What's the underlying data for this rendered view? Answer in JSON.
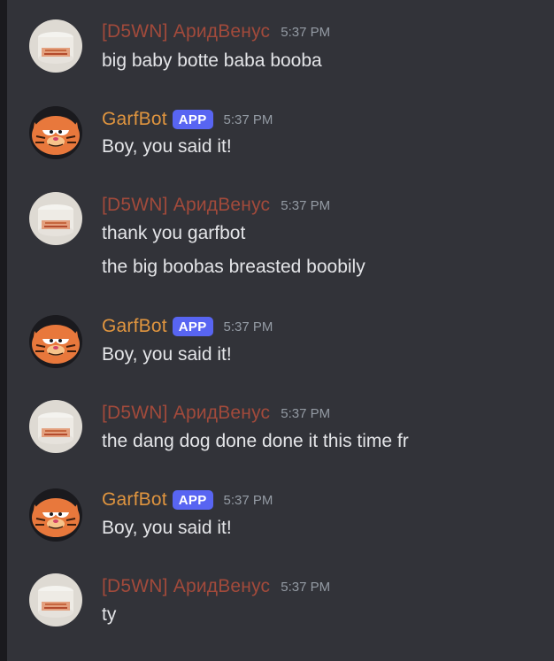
{
  "messages": [
    {
      "author": "[D5WN] АридВенус",
      "author_type": "user",
      "avatar_icon": "jar-avatar-icon",
      "time": "5:37 PM",
      "lines": [
        "big baby botte baba booba"
      ]
    },
    {
      "author": "GarfBot",
      "author_type": "bot",
      "badge": "APP",
      "avatar_icon": "garfield-avatar-icon",
      "time": "5:37 PM",
      "lines": [
        "Boy, you said it!"
      ]
    },
    {
      "author": "[D5WN] АридВенус",
      "author_type": "user",
      "avatar_icon": "jar-avatar-icon",
      "time": "5:37 PM",
      "lines": [
        "thank you garfbot",
        "the big boobas breasted boobily"
      ]
    },
    {
      "author": "GarfBot",
      "author_type": "bot",
      "badge": "APP",
      "avatar_icon": "garfield-avatar-icon",
      "time": "5:37 PM",
      "lines": [
        "Boy, you said it!"
      ]
    },
    {
      "author": "[D5WN] АридВенус",
      "author_type": "user",
      "avatar_icon": "jar-avatar-icon",
      "time": "5:37 PM",
      "lines": [
        "the dang dog done done it this time fr"
      ]
    },
    {
      "author": "GarfBot",
      "author_type": "bot",
      "badge": "APP",
      "avatar_icon": "garfield-avatar-icon",
      "time": "5:37 PM",
      "lines": [
        "Boy, you said it!"
      ]
    },
    {
      "author": "[D5WN] АридВенус",
      "author_type": "user",
      "avatar_icon": "jar-avatar-icon",
      "time": "5:37 PM",
      "lines": [
        "ty"
      ]
    }
  ],
  "colors": {
    "background": "#323339",
    "user_name": "#a24a3b",
    "bot_name": "#e0953f",
    "app_badge": "#5865f2",
    "timestamp": "#949ba4",
    "message_text": "#e4e5e8"
  }
}
